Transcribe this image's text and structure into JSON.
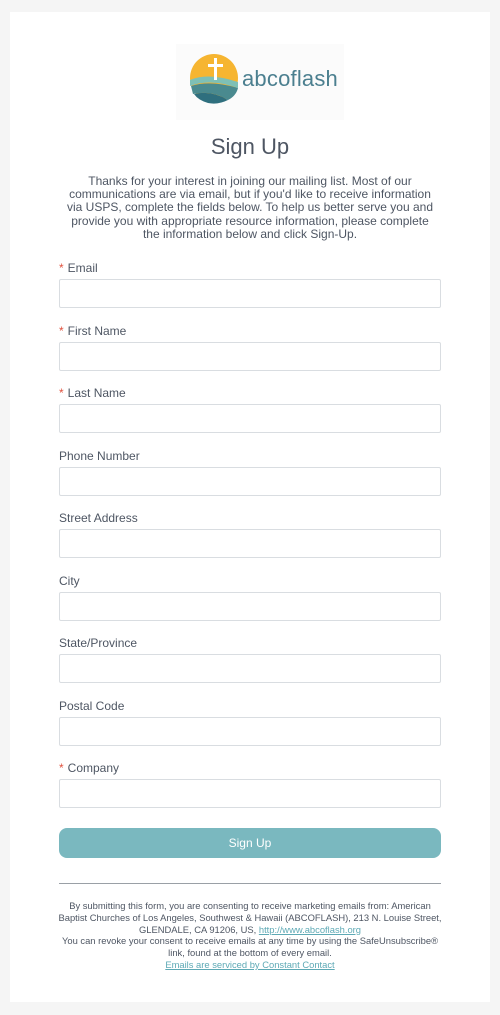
{
  "brand": {
    "name": "abcoflash",
    "icon": "cross-logo-icon",
    "colors": {
      "sun": "#f6b531",
      "wave1": "#7ec0b6",
      "wave2": "#4a8a8f",
      "wave3": "#2f6f7e",
      "text": "#4b7f8f"
    }
  },
  "title": "Sign Up",
  "intro": "Thanks for your interest in joining our mailing list. Most of our communications are via email, but if you'd like to receive information via USPS, complete the fields below. To help us better serve you and provide you with appropriate resource information, please complete the information below and click Sign-Up.",
  "fields": [
    {
      "label": "Email",
      "required": true,
      "value": ""
    },
    {
      "label": "First Name",
      "required": true,
      "value": ""
    },
    {
      "label": "Last Name",
      "required": true,
      "value": ""
    },
    {
      "label": "Phone Number",
      "required": false,
      "value": ""
    },
    {
      "label": "Street Address",
      "required": false,
      "value": ""
    },
    {
      "label": "City",
      "required": false,
      "value": ""
    },
    {
      "label": "State/Province",
      "required": false,
      "value": ""
    },
    {
      "label": "Postal Code",
      "required": false,
      "value": ""
    },
    {
      "label": "Company",
      "required": true,
      "value": ""
    }
  ],
  "required_marker": "*",
  "submit_label": "Sign Up",
  "accent": "#7ab8bf",
  "footer": {
    "consent": "By submitting this form, you are consenting to receive marketing emails from: American Baptist Churches of Los Angeles, Southwest & Hawaii (ABCOFLASH), 213 N. Louise Street, GLENDALE, CA 91206, US,",
    "site_link": "http://www.abcoflash.org",
    "revoke": "You can revoke your consent to receive emails at any time by using the SafeUnsubscribe® link, found at the bottom of every email.",
    "service_link": "Emails are serviced by Constant Contact"
  }
}
